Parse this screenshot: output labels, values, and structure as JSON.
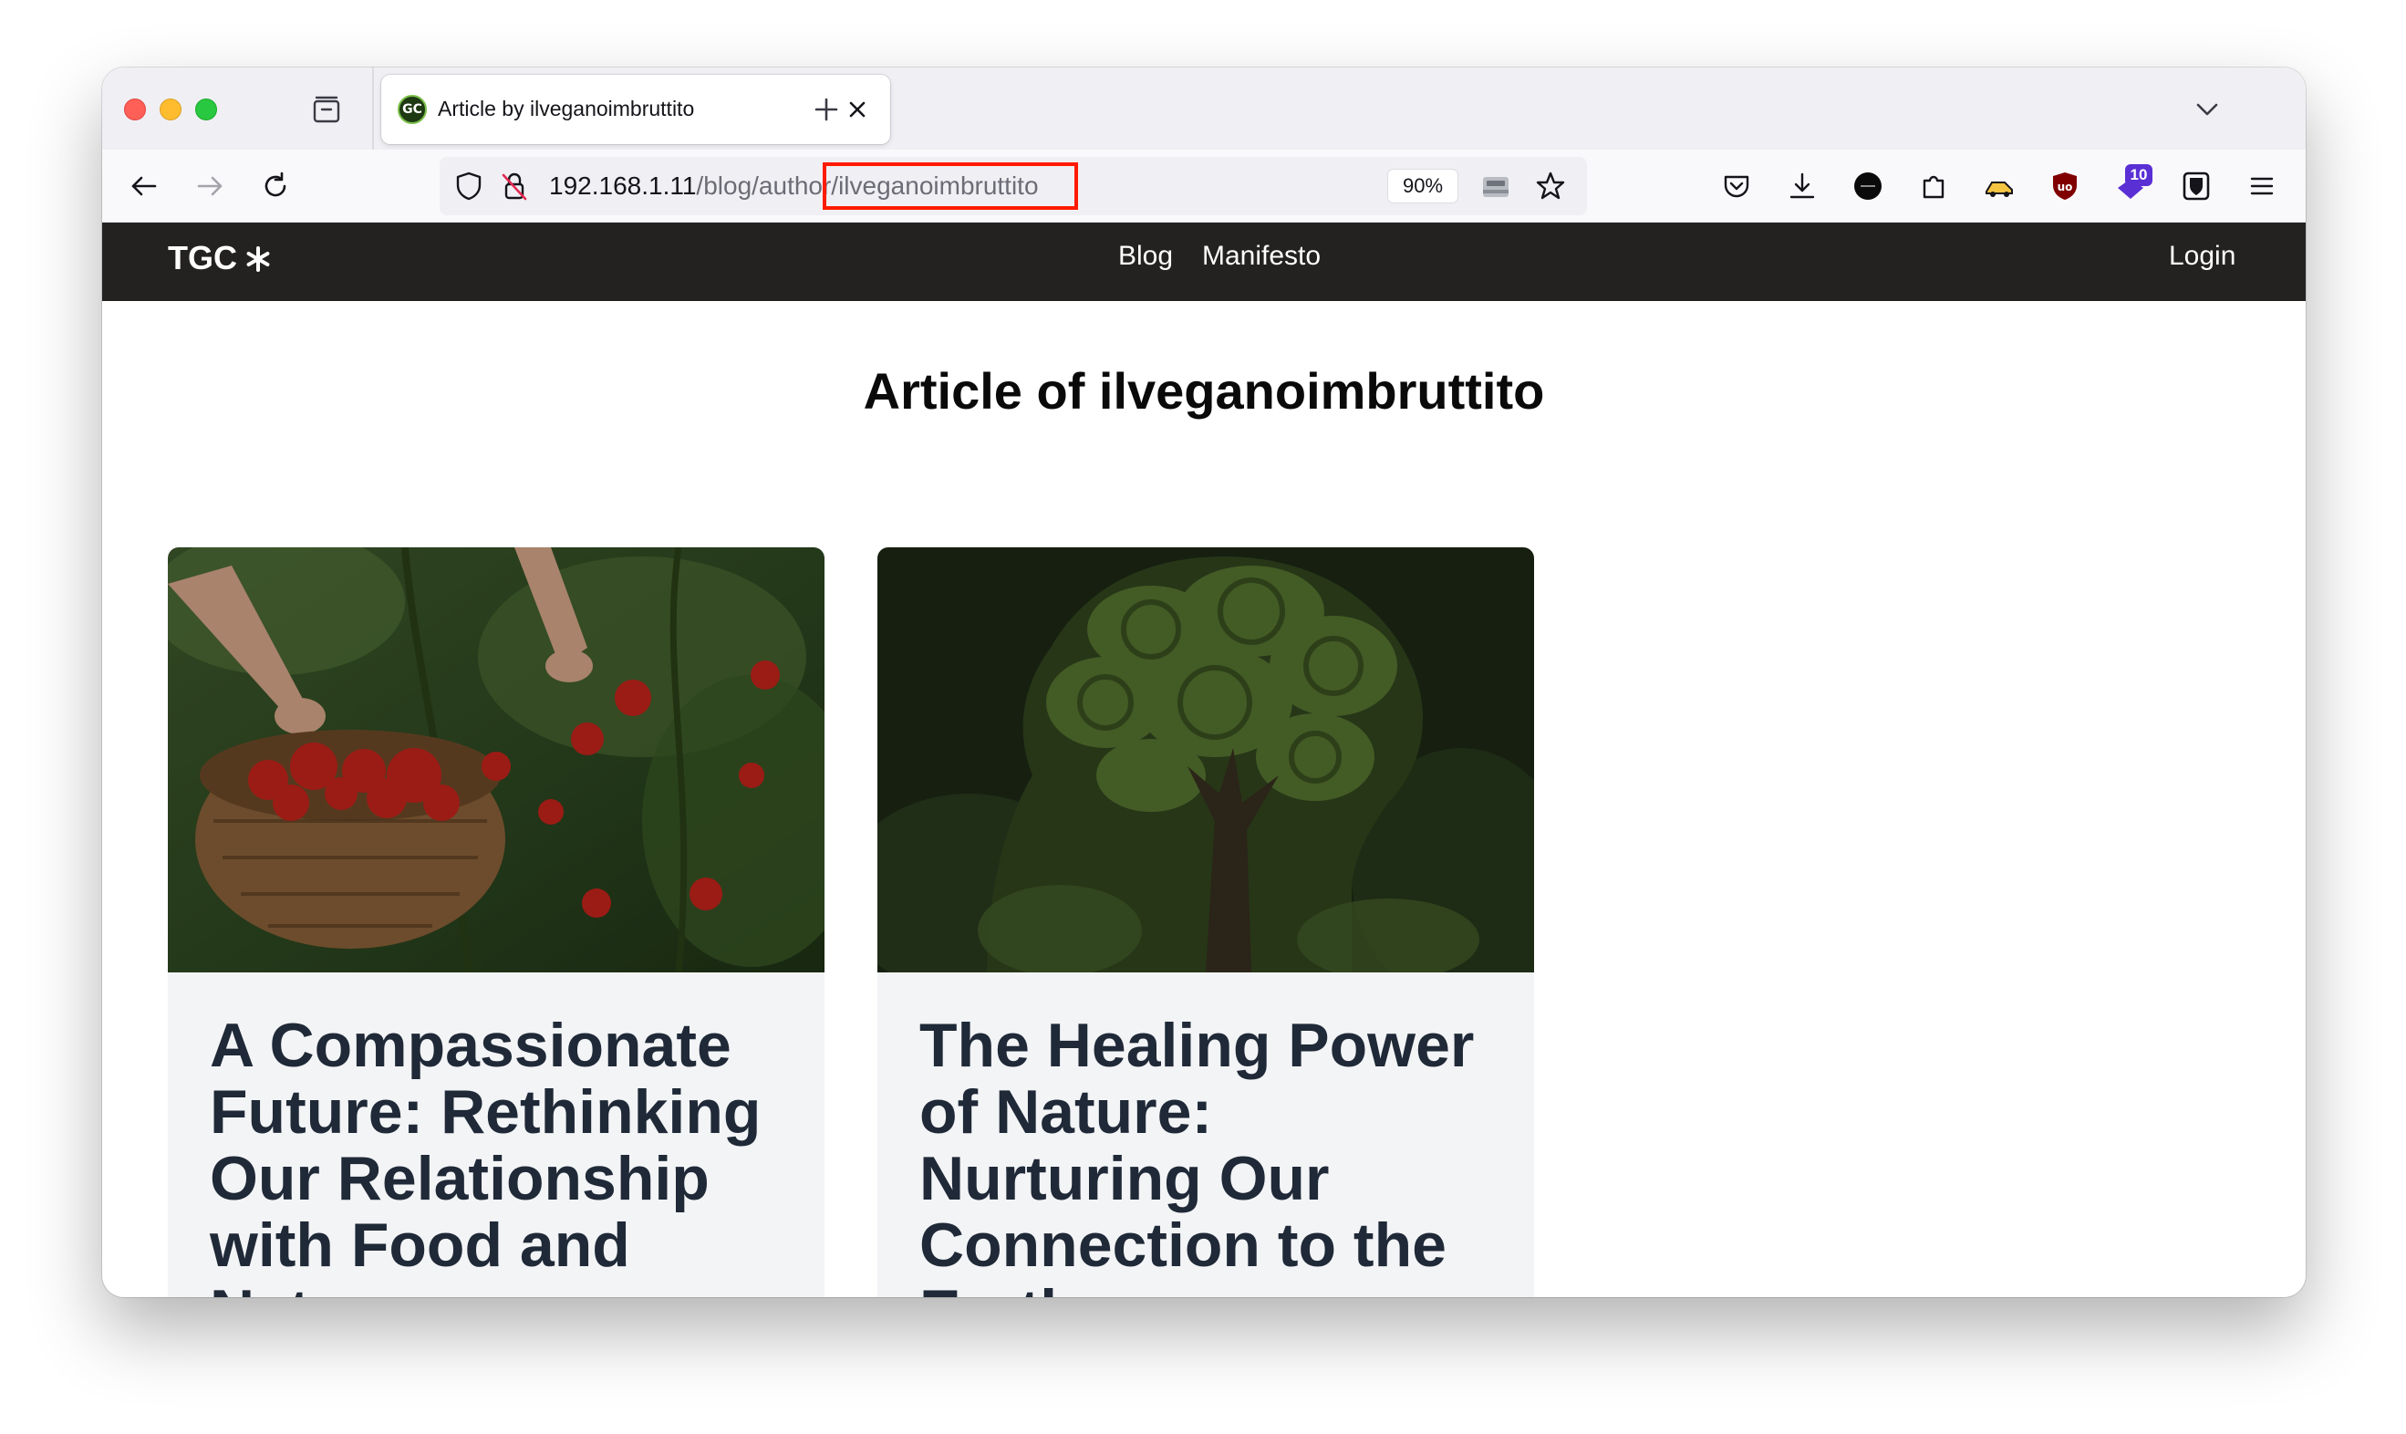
{
  "browser": {
    "tab": {
      "favicon_text": "GC",
      "title": "Article by ilveganoimbruttito"
    },
    "url": {
      "host": "192.168.1.11",
      "path": "/blog/author/ilveganoimbruttito"
    },
    "zoom": "90%",
    "extension_badge": "10"
  },
  "site": {
    "brand": "TGC",
    "nav": [
      "Blog",
      "Manifesto"
    ],
    "login": "Login"
  },
  "page": {
    "title": "Article of ilveganoimbruttito",
    "articles": [
      {
        "title": "A Compassionate Future: Rethinking Our Relationship with Food and Nature",
        "image": "basket-of-tomatoes-image"
      },
      {
        "title": "The Healing Power of Nature: Nurturing Our Connection to the Earth",
        "image": "tree-head-silhouette-image"
      }
    ]
  },
  "colors": {
    "header_bg": "#242220",
    "card_bg": "#f3f4f6",
    "highlight": "#ff1a00",
    "title_text": "#1f2937"
  }
}
